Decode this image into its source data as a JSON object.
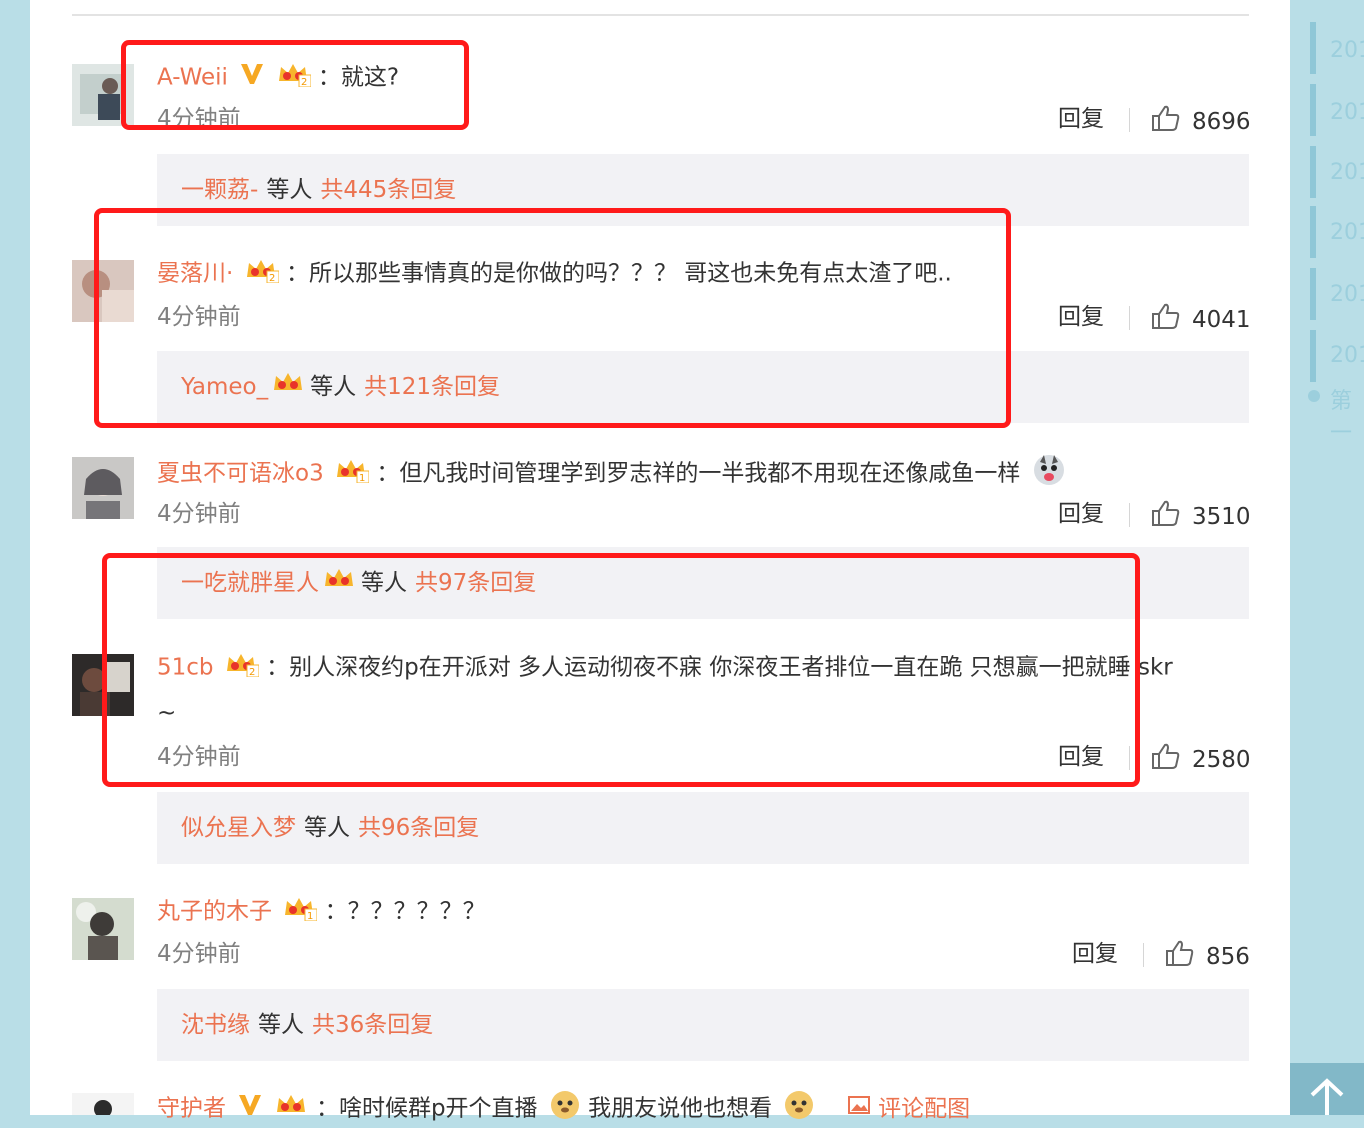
{
  "comments": [
    {
      "user": "A-Weii",
      "verified": true,
      "crown_level": "2",
      "text": "：就这?",
      "time": "4分钟前",
      "reply": "回复",
      "likes": "8696",
      "sub_user": "一颗荔-",
      "sub_mid": "等人",
      "sub_count": "共445条回复"
    },
    {
      "user": "晏落川·",
      "verified": false,
      "crown_level": "2",
      "text": "：所以那些事情真的是你做的吗？？？ 哥这也未免有点太渣了吧..",
      "time": "4分钟前",
      "reply": "回复",
      "likes": "4041",
      "sub_user": "Yameo_",
      "sub_mid": "等人",
      "sub_count": "共121条回复"
    },
    {
      "user": "夏虫不可语冰o3",
      "verified": false,
      "crown_level": "1",
      "text": "：但凡我时间管理学到罗志祥的一半我都不用现在还像咸鱼一样",
      "time": "4分钟前",
      "reply": "回复",
      "likes": "3510",
      "sub_user": "一吃就胖星人",
      "sub_mid": "等人",
      "sub_count": "共97条回复"
    },
    {
      "user": "51cb",
      "verified": false,
      "crown_level": "2",
      "text": "：别人深夜约p在开派对 多人运动彻夜不寐 你深夜王者排位一直在跪 只想赢一把就睡  skr",
      "text2": "~",
      "time": "4分钟前",
      "reply": "回复",
      "likes": "2580",
      "sub_user": "似允星入梦",
      "sub_mid": "等人",
      "sub_count": "共96条回复"
    },
    {
      "user": "丸子的木子",
      "verified": false,
      "crown_level": "1",
      "text": "：？？？？？？",
      "time": "4分钟前",
      "reply": "回复",
      "likes": "856",
      "sub_user": "沈书缘",
      "sub_mid": "等人",
      "sub_count": "共36条回复"
    },
    {
      "user": "守护者",
      "verified": true,
      "crown_level": "2",
      "text": "：啥时候群p开个直播",
      "text_after": "我朋友说他也想看",
      "pic_label": "评论配图"
    }
  ],
  "timeline": {
    "years": [
      "201",
      "201",
      "201",
      "201",
      "201",
      "201"
    ],
    "first": "第一"
  },
  "colors": {
    "accent": "#eb7350",
    "highlight": "#ff1a1a",
    "sidebar": "#b9dee7"
  }
}
